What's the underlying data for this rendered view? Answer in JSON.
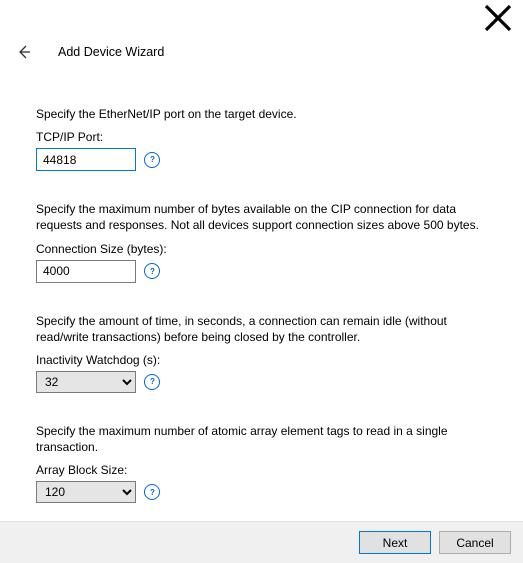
{
  "window": {
    "title": "Add Device Wizard"
  },
  "sections": {
    "port": {
      "desc": "Specify the EtherNet/IP port on the target device.",
      "label": "TCP/IP Port:",
      "value": "44818"
    },
    "conn": {
      "desc": "Specify the maximum number of bytes available on the CIP connection for data requests and responses. Not all devices support connection sizes above 500 bytes.",
      "label": "Connection Size (bytes):",
      "value": "4000"
    },
    "watchdog": {
      "desc": "Specify the amount of time, in seconds, a connection can remain idle (without read/write transactions) before being closed by the controller.",
      "label": "Inactivity Watchdog (s):",
      "value": "32"
    },
    "array": {
      "desc": "Specify the maximum number of atomic array element tags to read in a single transaction.",
      "label": "Array Block Size:",
      "value": "120"
    }
  },
  "footer": {
    "next": "Next",
    "cancel": "Cancel"
  }
}
